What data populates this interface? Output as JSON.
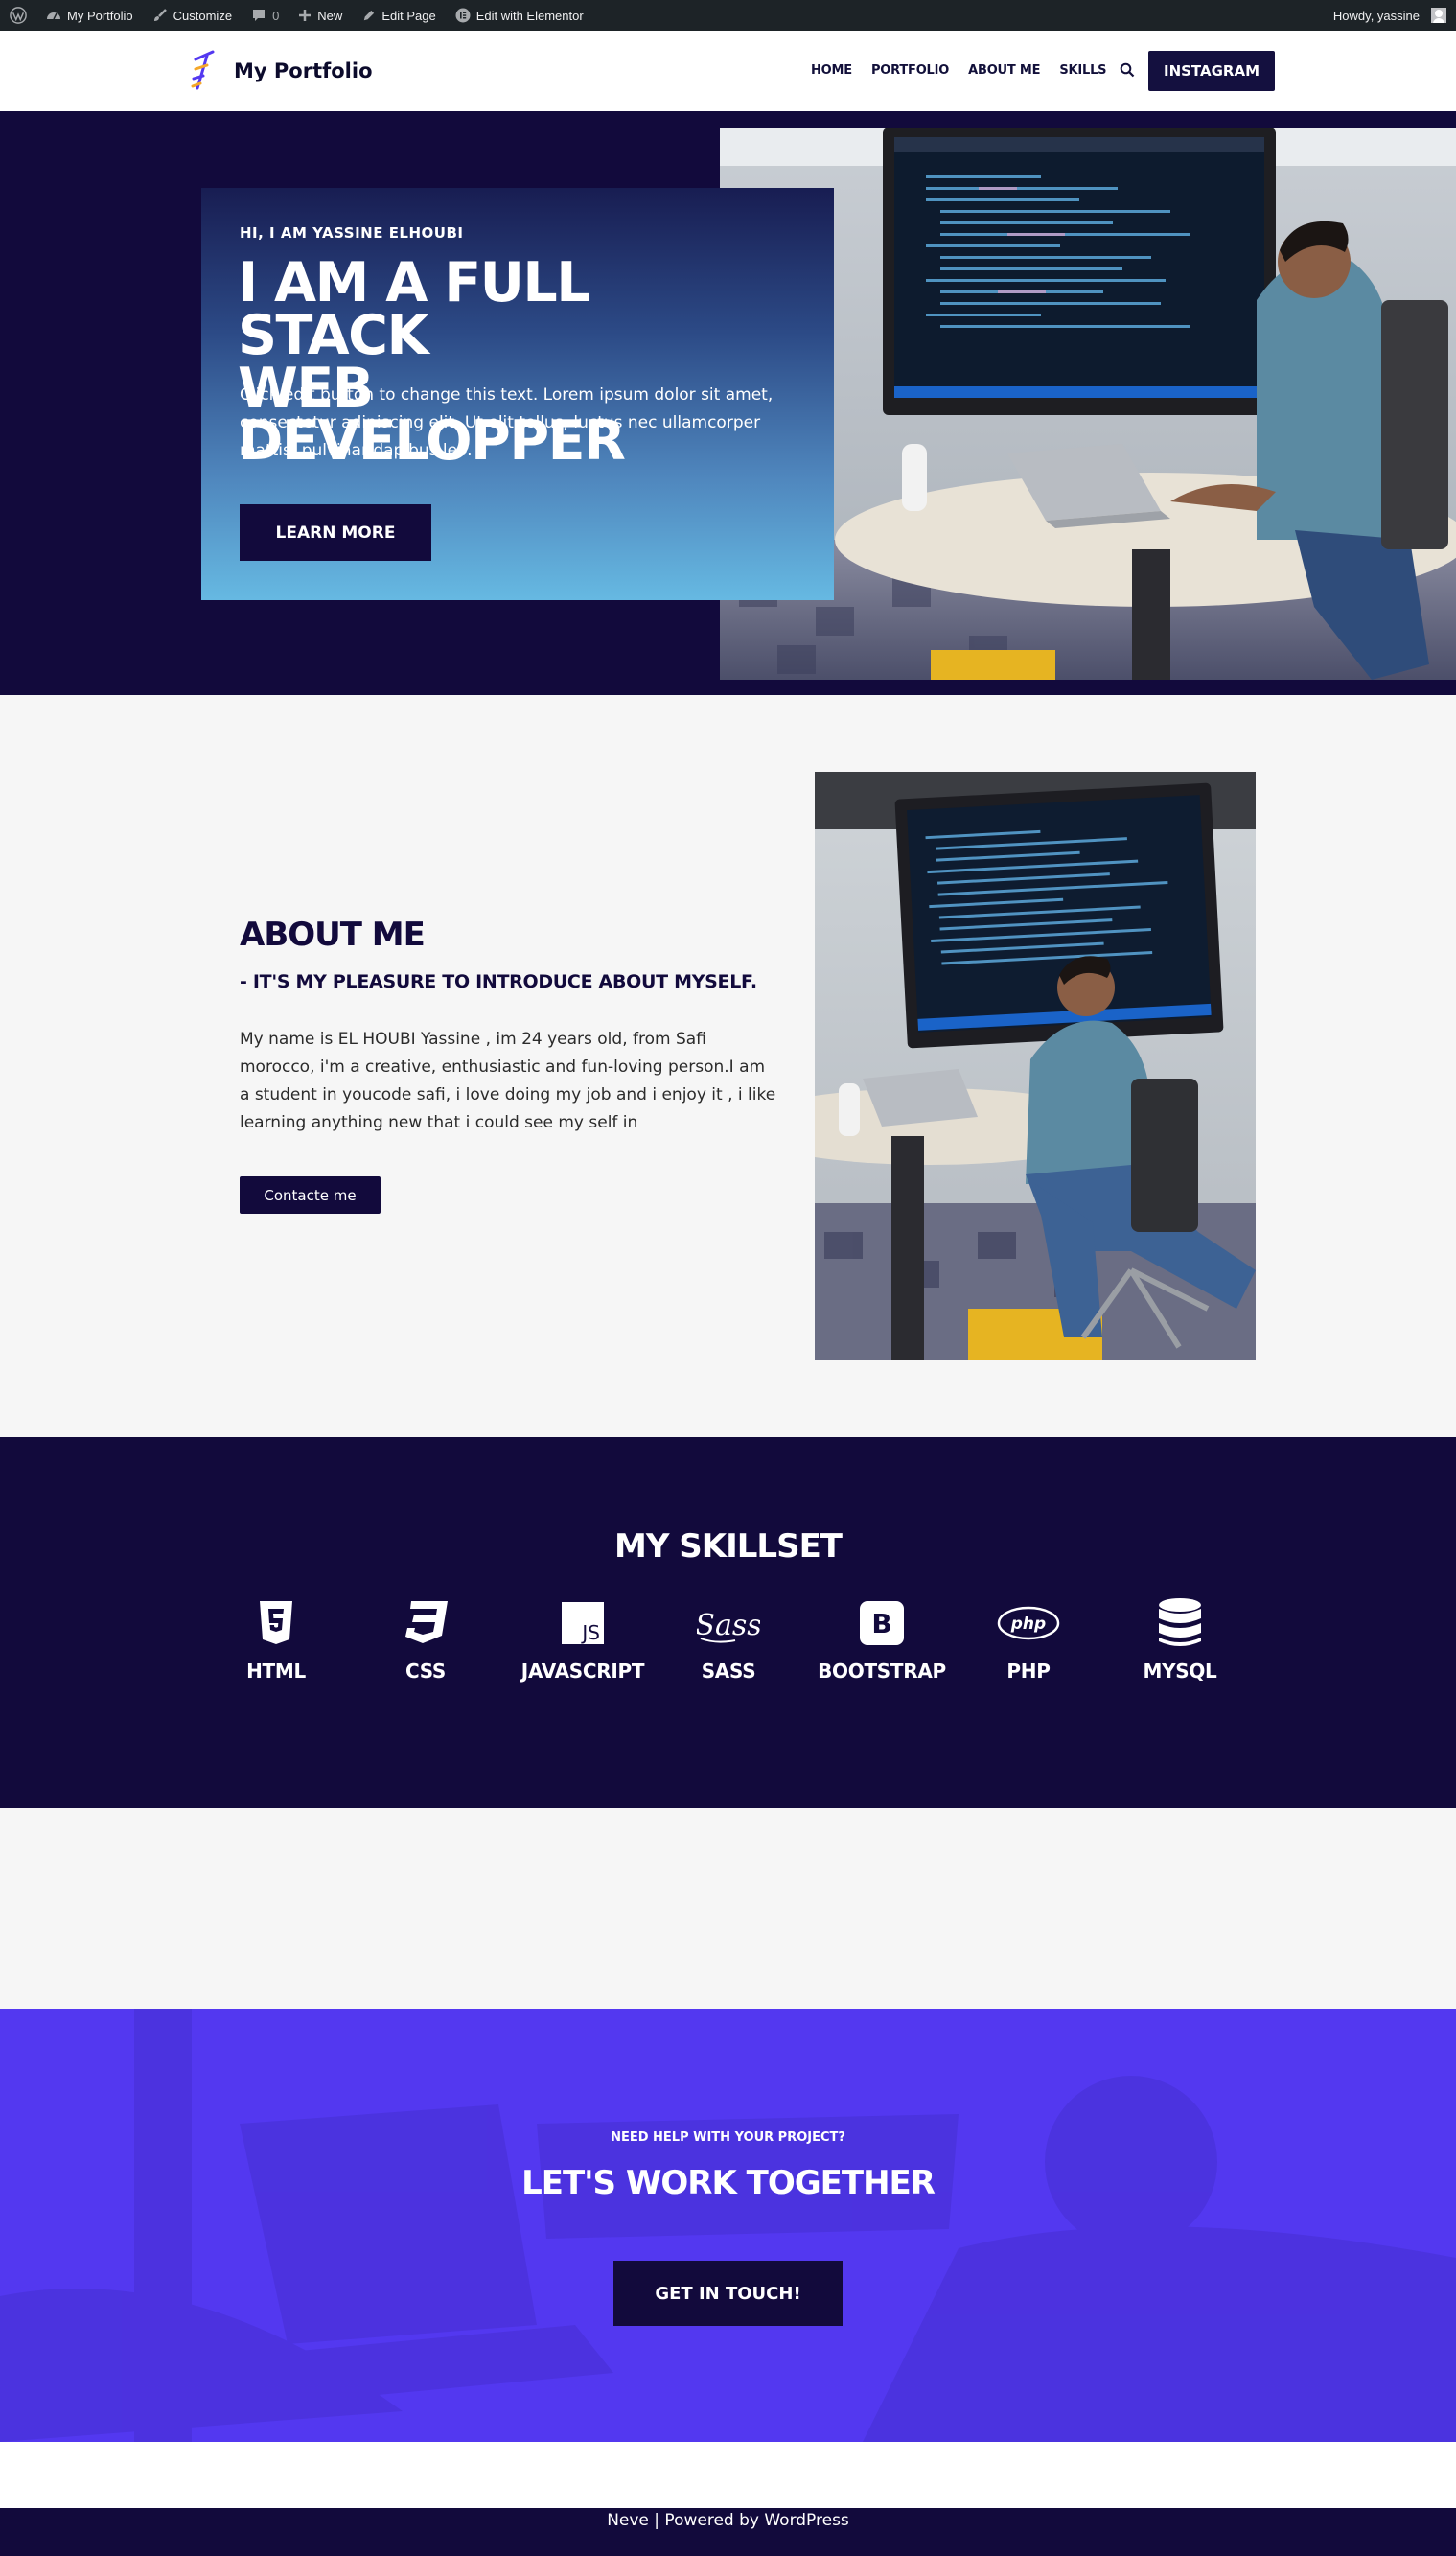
{
  "adminbar": {
    "site": "My Portfolio",
    "customize": "Customize",
    "comments": "0",
    "new": "New",
    "edit_page": "Edit Page",
    "elementor": "Edit with Elementor",
    "howdy": "Howdy, yassine"
  },
  "header": {
    "site_title": "My Portfolio",
    "nav": [
      "HOME",
      "PORTFOLIO",
      "ABOUT ME",
      "SKILLS"
    ],
    "cta": "INSTAGRAM"
  },
  "hero": {
    "eyebrow": "HI, I AM YASSINE ELHOUBI",
    "title_line1": "I AM A FULL STACK",
    "title_line2": "WEB DEVELOPPER",
    "text": "Click edit button to change this text. Lorem ipsum dolor sit amet, consectetur adipiscing elit. Ut elit tellus, luctus nec ullamcorper mattis, pulvinar dapibus leo.",
    "button": "LEARN MORE"
  },
  "about": {
    "title": "ABOUT ME",
    "subtitle": "- IT'S MY PLEASURE TO INTRODUCE ABOUT MYSELF.",
    "text": "My name is EL HOUBI Yassine , im 24 years old, from Safi morocco, i'm a creative, enthusiastic and fun-loving person.I am a student in youcode safi, i love doing my job and i enjoy it , i like learning anything new that i could see my self in",
    "button": "Contacte me"
  },
  "skills": {
    "title": "MY SKILLSET",
    "items": [
      {
        "label": "HTML",
        "icon": "html5-icon"
      },
      {
        "label": "CSS",
        "icon": "css3-icon"
      },
      {
        "label": "JAVASCRIPT",
        "icon": "js-icon"
      },
      {
        "label": "SASS",
        "icon": "sass-icon"
      },
      {
        "label": "BOOTSTRAP",
        "icon": "bootstrap-icon"
      },
      {
        "label": "PHP",
        "icon": "php-icon"
      },
      {
        "label": "MYSQL",
        "icon": "database-icon"
      }
    ]
  },
  "cta": {
    "eyebrow": "NEED HELP WITH YOUR PROJECT?",
    "title": "LET'S WORK TOGETHER",
    "button": "GET IN TOUCH!"
  },
  "footer": {
    "text": "Neve | Powered by WordPress"
  },
  "colors": {
    "navy": "#120a3c",
    "purple": "#5338f0",
    "admin": "#1d2327"
  }
}
